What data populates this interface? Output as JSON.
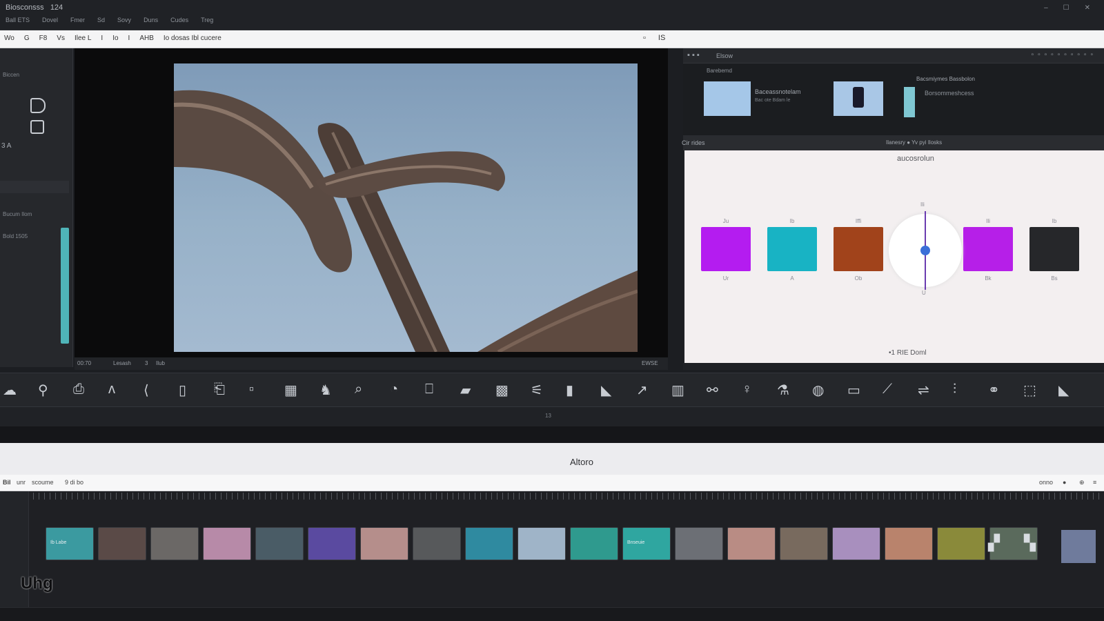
{
  "app": {
    "name": "Biosconsss",
    "version": "124",
    "window_controls": [
      "–",
      "☐",
      "✕"
    ]
  },
  "menu": [
    "Ball ETS",
    "Dovel",
    "Fmer",
    "Sd",
    "Sovy",
    "Duns",
    "Cudes",
    "Treg"
  ],
  "toolbar": {
    "items": [
      "Wo",
      "G",
      "F8",
      "Vs",
      "Ilee L",
      "I",
      "Io",
      "I",
      "AHB",
      "Io dosas Ibl cucere"
    ],
    "right": [
      "▫",
      "IS"
    ]
  },
  "left_panel": {
    "section": "Biccen",
    "label1": "Bucum Ilom",
    "label2": "Bold 1505",
    "item_a": "3 A"
  },
  "viewer_bar": {
    "timecode": "00:70",
    "label": "Lesash",
    "index": "3",
    "mode": "Ilub",
    "right": "EWSE"
  },
  "right_panel": {
    "header": "Elsow",
    "media": {
      "folder": "Barebemd",
      "clip1_caption": "Baceassnotelam",
      "clip1_sub": "Bac ote Bdam le",
      "clip2_caption": "Borsommeshcess",
      "header2": "Bacsmiymes Bassbolon"
    },
    "sub_header": {
      "left": "Cir rides",
      "right": "Ilanesry  ●  Yv pyi Ilosks"
    },
    "canvas_title": "aucosrolun",
    "canvas_footer": "•1 RIE Doml",
    "swatches": [
      {
        "color": "#b41cf0",
        "top": "Ju",
        "bottom": "Ur"
      },
      {
        "color": "#18b3c4",
        "top": "Ib",
        "bottom": "A"
      },
      {
        "color": "#a1431b",
        "top": "Iffi",
        "bottom": "Ob"
      },
      {
        "color": "#b61fe8",
        "top": "Ili",
        "bottom": "Bk"
      },
      {
        "color": "#26272a",
        "top": "Ib",
        "bottom": "Bs"
      }
    ],
    "dial": {
      "top": "Ili",
      "bottom": "U"
    }
  },
  "fx_row": {
    "tools": [
      "☁",
      "⚲",
      "⎙",
      "ᴧ",
      "⟨",
      "▯",
      "⎗",
      "▫",
      "▦",
      "♞",
      "⌕",
      "◔",
      "⎕",
      "▰",
      "▩",
      "⚟",
      "▮",
      "◣",
      "↗",
      "▥",
      "⚯",
      "♀",
      "⚗",
      "◍",
      "▭",
      "⟋",
      "⇌",
      "⫶",
      "⚭",
      "⬚",
      "◣"
    ],
    "ruler_mark": "13"
  },
  "band": {
    "title": "Altoro"
  },
  "timeline_head": {
    "left": "Bil",
    "tab1": "unr",
    "tab2": "scoume",
    "tab3": "9 di bo",
    "right1": "onno",
    "right2": "●",
    "right3": "⊕",
    "right4": "≡"
  },
  "timeline": {
    "clips": [
      {
        "bg": "#3b9aa0",
        "label": "Ib Labe"
      },
      {
        "bg": "#5a4a47",
        "label": ""
      },
      {
        "bg": "#6b6866",
        "label": ""
      },
      {
        "bg": "#b78aa8",
        "label": ""
      },
      {
        "bg": "#4a5c66",
        "label": ""
      },
      {
        "bg": "#5a4aa0",
        "label": ""
      },
      {
        "bg": "#b58e8b",
        "label": ""
      },
      {
        "bg": "#57595b",
        "label": ""
      },
      {
        "bg": "#2f8aa0",
        "label": ""
      },
      {
        "bg": "#9fb4c8",
        "label": ""
      },
      {
        "bg": "#2f9a8e",
        "label": ""
      },
      {
        "bg": "#2fa6a0",
        "label": "Bnseuie"
      },
      {
        "bg": "#6c6f75",
        "label": ""
      },
      {
        "bg": "#b98c84",
        "label": ""
      },
      {
        "bg": "#786a5e",
        "label": ""
      },
      {
        "bg": "#a88fbe",
        "label": ""
      },
      {
        "bg": "#b9836c",
        "label": ""
      },
      {
        "bg": "#8a8a3a",
        "label": ""
      },
      {
        "bg": "#5a6a5c",
        "label": ""
      }
    ],
    "loose": [
      "▞",
      "▚",
      "▩"
    ]
  },
  "logo": "Uhg"
}
